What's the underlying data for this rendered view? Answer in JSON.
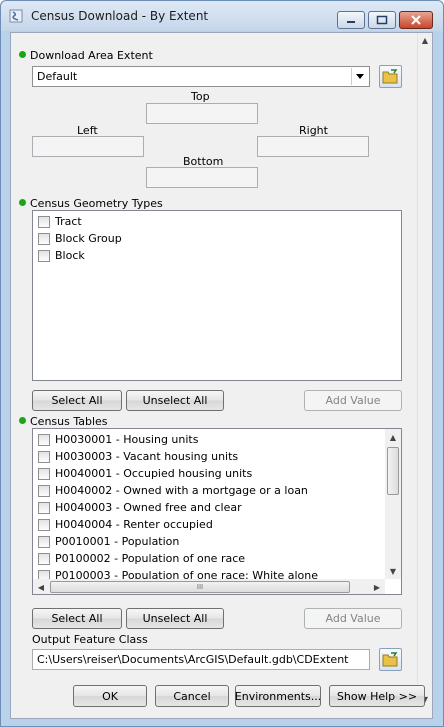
{
  "window": {
    "title": "Census Download - By Extent"
  },
  "extent": {
    "label": "Download Area Extent",
    "selected": "Default",
    "top_label": "Top",
    "left_label": "Left",
    "right_label": "Right",
    "bottom_label": "Bottom",
    "top": "",
    "left": "",
    "right": "",
    "bottom": ""
  },
  "geometry": {
    "label": "Census Geometry Types",
    "items": [
      "Tract",
      "Block Group",
      "Block"
    ],
    "select_all": "Select All",
    "unselect_all": "Unselect All",
    "add_value": "Add Value"
  },
  "tables": {
    "label": "Census Tables",
    "items": [
      "H0030001 - Housing units",
      "H0030003 - Vacant housing units",
      "H0040001 - Occupied housing units",
      "H0040002 - Owned with a mortgage or a loan",
      "H0040003 - Owned free and clear",
      "H0040004 - Renter occupied",
      "P0010001 - Population",
      "P0100002 - Population of one race",
      "P0100003 - Population of one race: White alone"
    ],
    "hscroll_grip": "III",
    "select_all": "Select All",
    "unselect_all": "Unselect All",
    "add_value": "Add Value"
  },
  "output": {
    "label": "Output Feature Class",
    "value": "C:\\Users\\reiser\\Documents\\ArcGIS\\Default.gdb\\CDExtent"
  },
  "buttons": {
    "ok": "OK",
    "cancel": "Cancel",
    "environments": "Environments...",
    "help": "Show Help >>"
  }
}
